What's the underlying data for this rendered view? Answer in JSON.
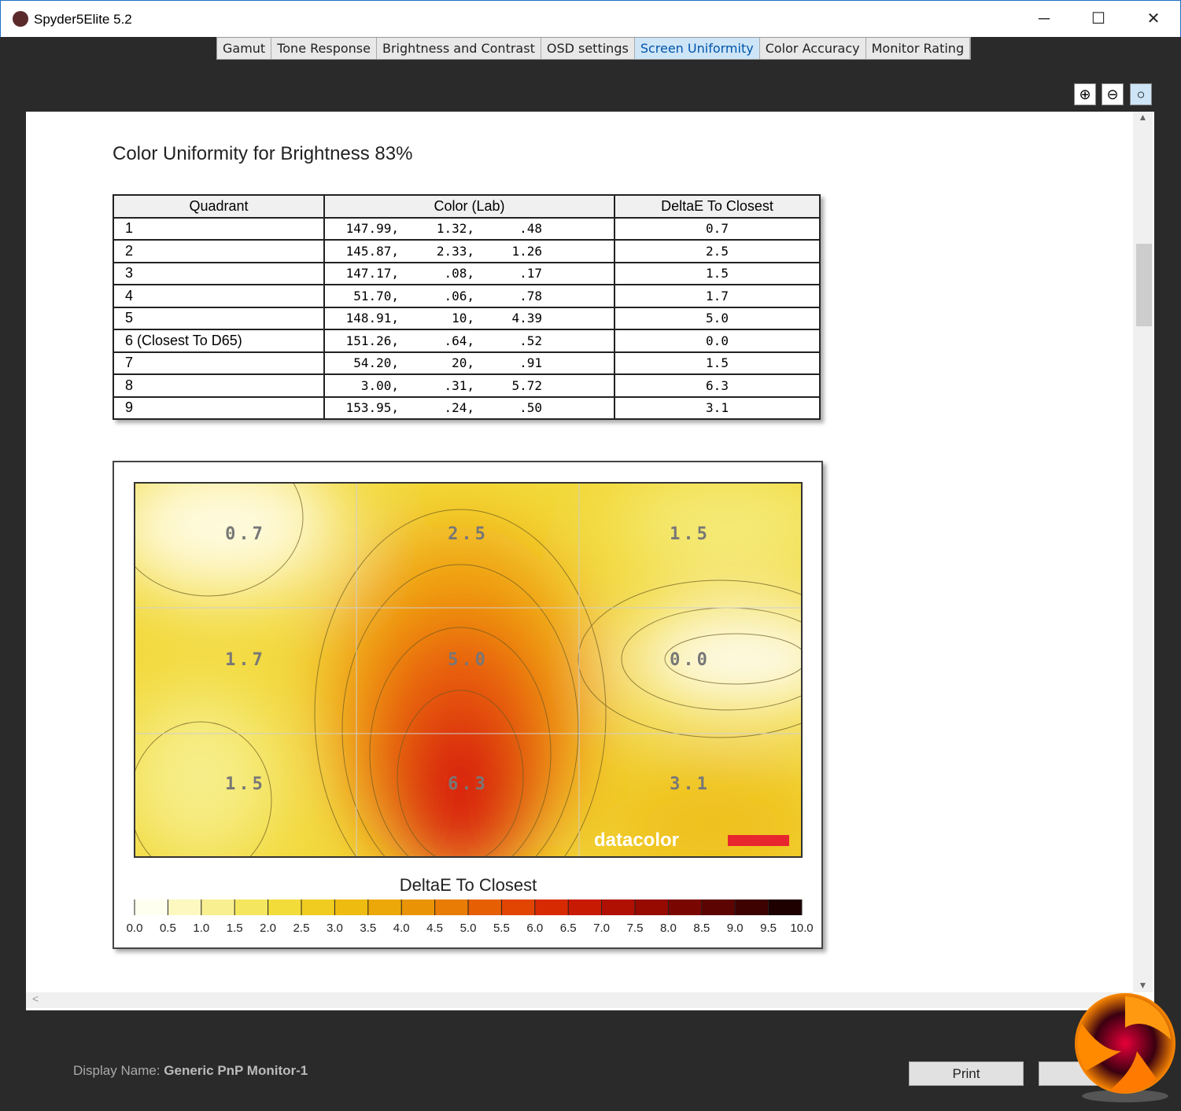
{
  "window": {
    "title": "Spyder5Elite 5.2",
    "minimize": "─",
    "maximize": "☐",
    "close": "✕"
  },
  "tabs": [
    {
      "label": "Gamut"
    },
    {
      "label": "Tone Response"
    },
    {
      "label": "Brightness and Contrast"
    },
    {
      "label": "OSD settings"
    },
    {
      "label": "Screen Uniformity",
      "active": true
    },
    {
      "label": "Color Accuracy"
    },
    {
      "label": "Monitor Rating"
    }
  ],
  "zoom": {
    "in": "zoom-in-icon",
    "out": "zoom-out-icon",
    "fit": "zoom-fit-icon"
  },
  "report": {
    "heading": "Color Uniformity for Brightness 83%",
    "columns": [
      "Quadrant",
      "Color (Lab)",
      "DeltaE To Closest"
    ],
    "rows": [
      {
        "q": "1",
        "lab": [
          "147.99,",
          "1.32,",
          ".48"
        ],
        "de": "0.7"
      },
      {
        "q": "2",
        "lab": [
          "145.87,",
          "2.33,",
          "1.26"
        ],
        "de": "2.5"
      },
      {
        "q": "3",
        "lab": [
          "147.17,",
          ".08,",
          ".17"
        ],
        "de": "1.5"
      },
      {
        "q": "4",
        "lab": [
          "51.70,",
          ".06,",
          ".78"
        ],
        "de": "1.7"
      },
      {
        "q": "5",
        "lab": [
          "148.91,",
          "10,",
          "4.39"
        ],
        "de": "5.0"
      },
      {
        "q": "6 (Closest To D65)",
        "lab": [
          "151.26,",
          ".64,",
          ".52"
        ],
        "de": "0.0"
      },
      {
        "q": "7",
        "lab": [
          "54.20,",
          "20,",
          ".91"
        ],
        "de": "1.5"
      },
      {
        "q": "8",
        "lab": [
          "3.00,",
          ".31,",
          "5.72"
        ],
        "de": "6.3"
      },
      {
        "q": "9",
        "lab": [
          "153.95,",
          ".24,",
          ".50"
        ],
        "de": "3.1"
      }
    ]
  },
  "chart_data": {
    "type": "heatmap",
    "title": "DeltaE To Closest",
    "grid": [
      [
        "0.7",
        "2.5",
        "1.5"
      ],
      [
        "1.7",
        "5.0",
        "0.0"
      ],
      [
        "1.5",
        "6.3",
        "3.1"
      ]
    ],
    "values": [
      [
        0.7,
        2.5,
        1.5
      ],
      [
        1.7,
        5.0,
        0.0
      ],
      [
        1.5,
        6.3,
        3.1
      ]
    ],
    "colorbar": {
      "label": "DeltaE To Closest",
      "range": [
        0,
        10
      ],
      "ticks": [
        "0.0",
        "0.5",
        "1.0",
        "1.5",
        "2.0",
        "2.5",
        "3.0",
        "3.5",
        "4.0",
        "4.5",
        "5.0",
        "5.5",
        "6.0",
        "6.5",
        "7.0",
        "7.5",
        "8.0",
        "8.5",
        "9.0",
        "9.5",
        "10.0"
      ]
    },
    "watermark": "datacolor"
  },
  "footer": {
    "display_label": "Display Name:",
    "display_value": "Generic PnP Monitor-1",
    "print": "Print",
    "other": ""
  }
}
